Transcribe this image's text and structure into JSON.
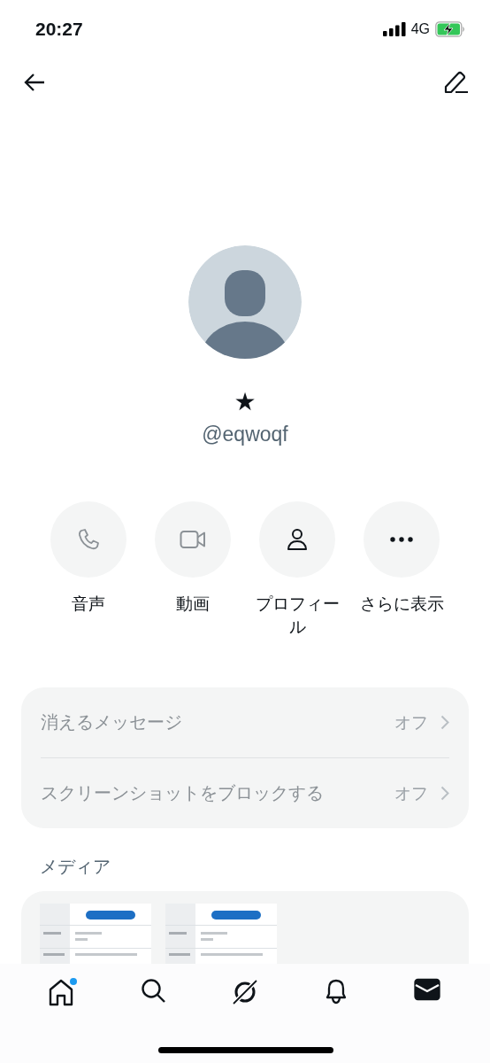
{
  "status_bar": {
    "time": "20:27",
    "network": "4G"
  },
  "profile": {
    "name": "★",
    "handle": "@eqwoqf"
  },
  "actions": [
    {
      "kind": "phone",
      "label": "音声",
      "disabled": true
    },
    {
      "kind": "video",
      "label": "動画",
      "disabled": true
    },
    {
      "kind": "profile",
      "label": "プロフィール",
      "disabled": false
    },
    {
      "kind": "more",
      "label": "さらに表示",
      "disabled": false
    }
  ],
  "settings": [
    {
      "label": "消えるメッセージ",
      "value": "オフ"
    },
    {
      "label": "スクリーンショットをブロックする",
      "value": "オフ"
    }
  ],
  "media": {
    "title": "メディア"
  },
  "nav": [
    {
      "kind": "home",
      "selected": false,
      "dot": true
    },
    {
      "kind": "search",
      "selected": false,
      "dot": false
    },
    {
      "kind": "grok",
      "selected": false,
      "dot": false
    },
    {
      "kind": "bell",
      "selected": false,
      "dot": false
    },
    {
      "kind": "mail",
      "selected": true,
      "dot": false
    }
  ]
}
